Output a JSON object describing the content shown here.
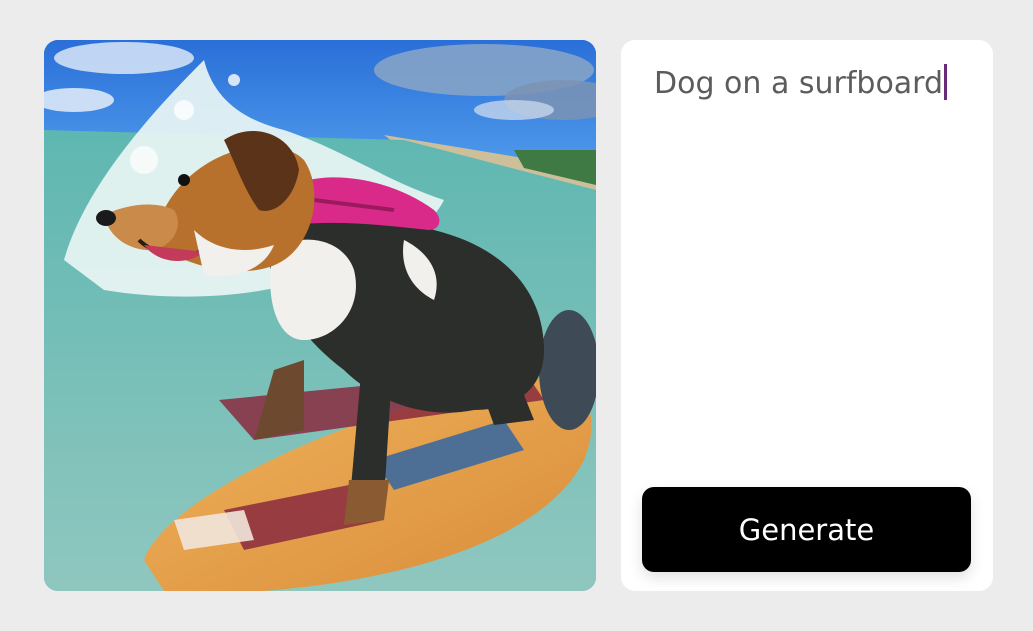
{
  "image": {
    "icon": "generated-image"
  },
  "prompt": {
    "value": "Dog on a surfboard"
  },
  "generate": {
    "label": "Generate"
  },
  "colors": {
    "background": "#ececec",
    "panel": "#ffffff",
    "button": "#000000",
    "button_text": "#ffffff",
    "caret": "#6b2a7a"
  }
}
